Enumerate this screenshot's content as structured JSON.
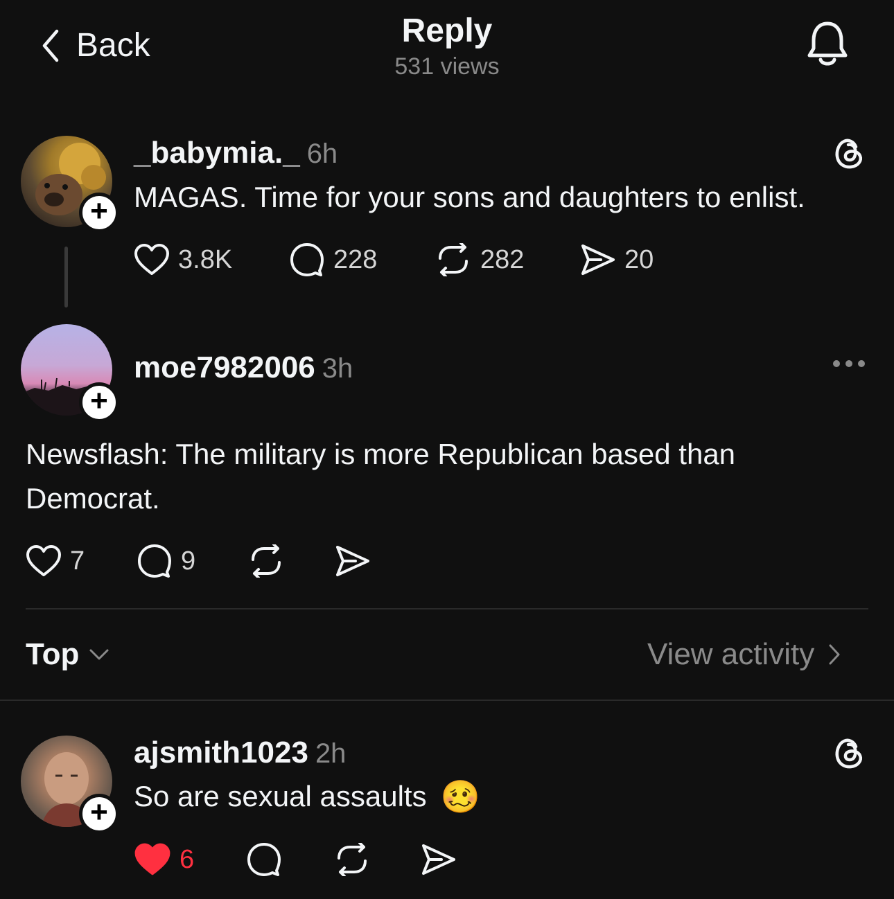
{
  "header": {
    "back_label": "Back",
    "title": "Reply",
    "views": "531 views"
  },
  "post": {
    "username": "_babymia._",
    "time": "6h",
    "text": "MAGAS. Time for your sons and daughters to enlist.",
    "likes": "3.8K",
    "comments": "228",
    "reposts": "282",
    "shares": "20"
  },
  "reply": {
    "username": "moe7982006",
    "time": "3h",
    "text_line1": "Newsflash: The military is more Republican based than",
    "text_line2": "Democrat.",
    "likes": "7",
    "comments": "9"
  },
  "sort": {
    "label": "Top",
    "view_activity": "View activity"
  },
  "comment": {
    "username": "ajsmith1023",
    "time": "2h",
    "text": "So are sexual assaults",
    "emoji": "🥴",
    "likes": "6",
    "liked": true
  },
  "colors": {
    "background": "#101010",
    "like_active": "#ff3040",
    "secondary_text": "#8a8a8a"
  }
}
